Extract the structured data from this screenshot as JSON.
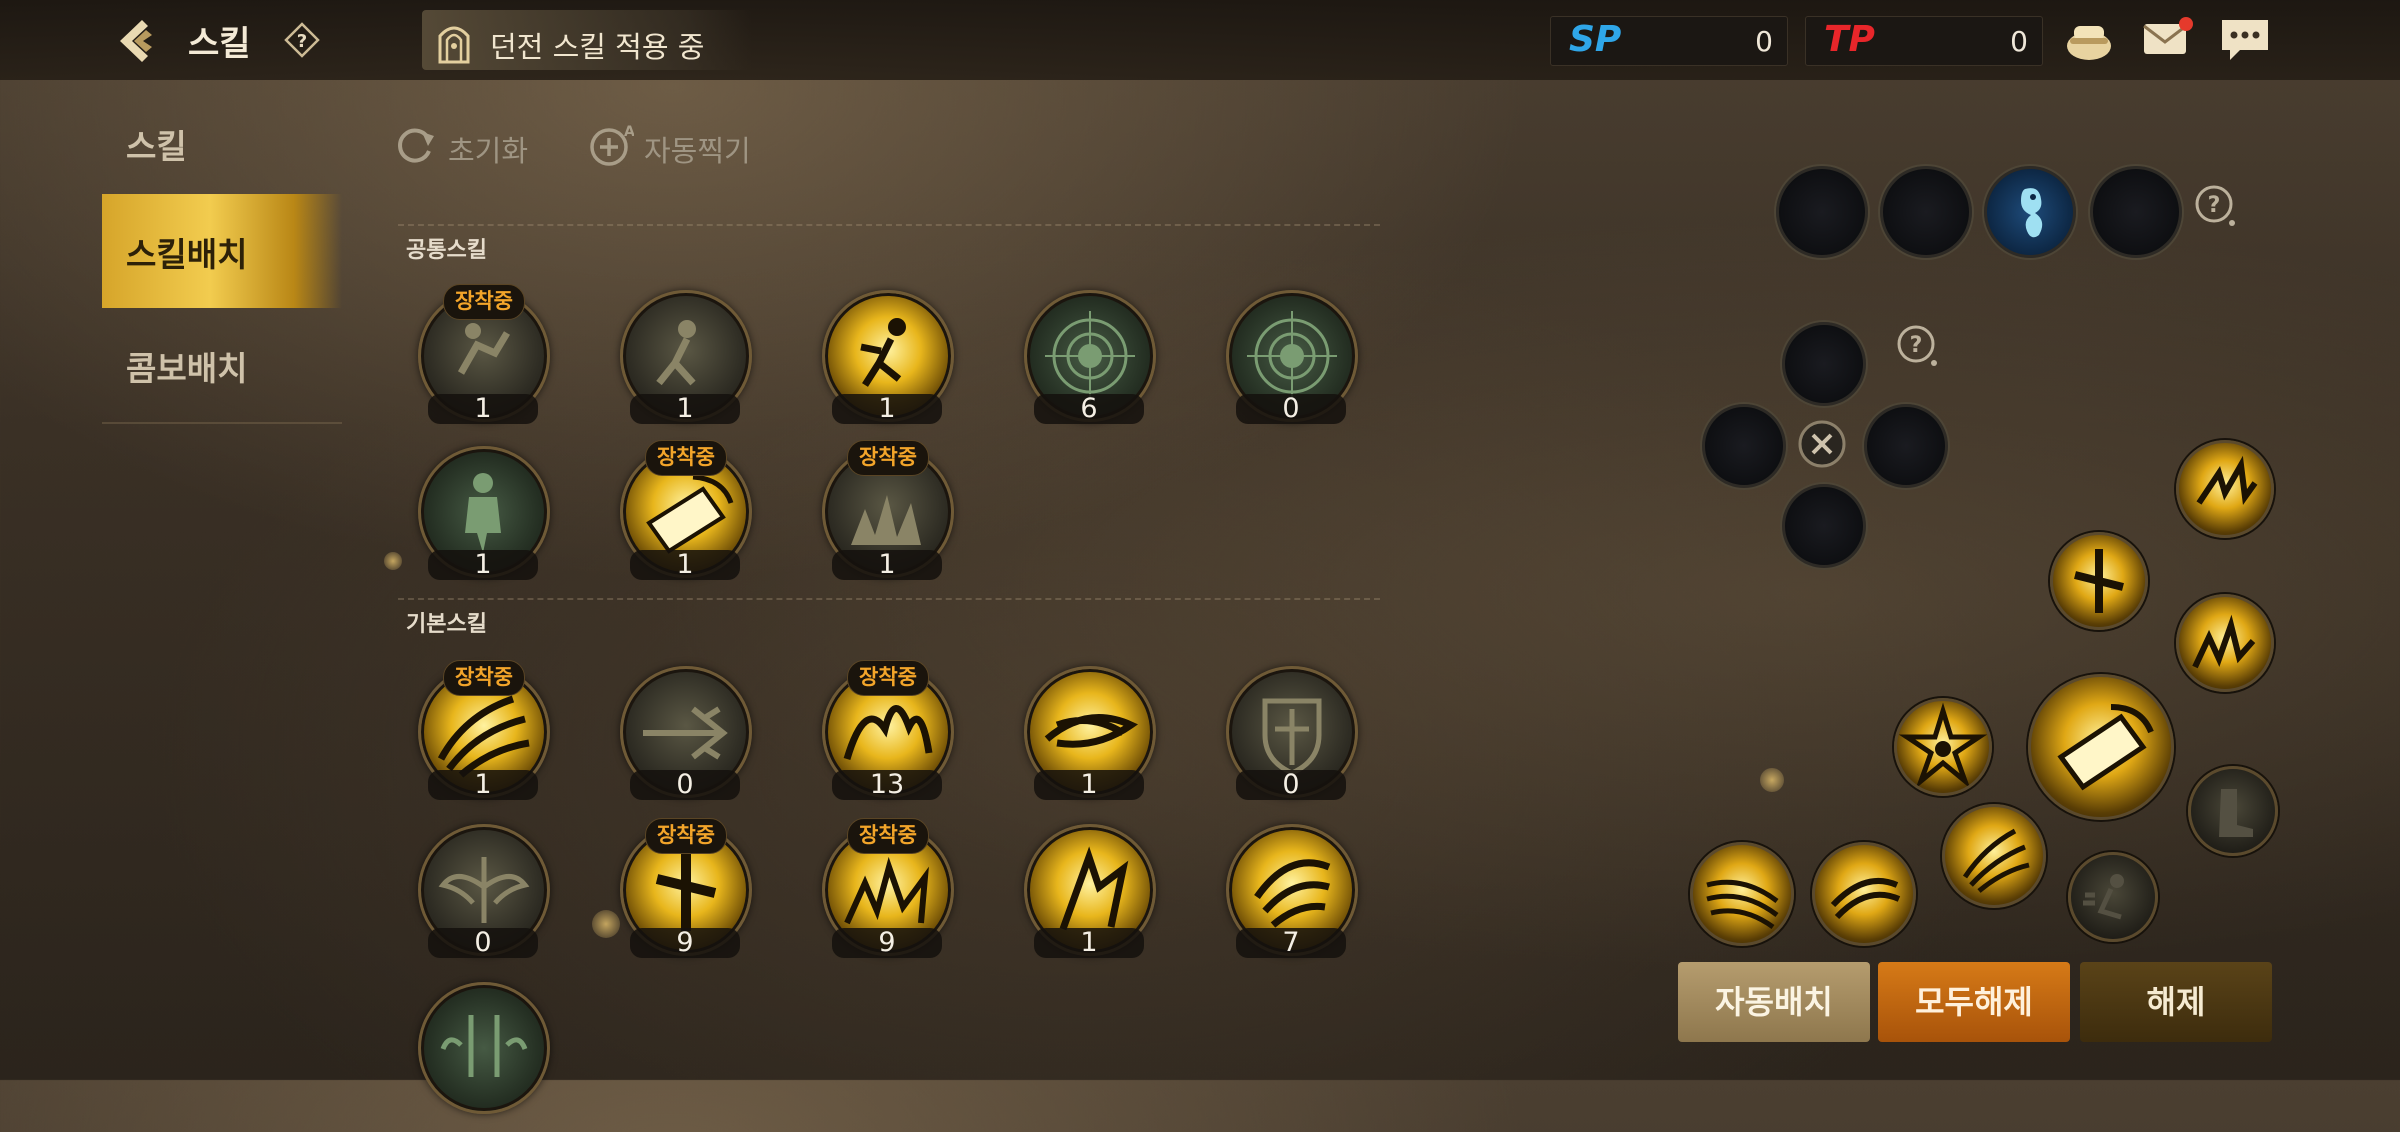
{
  "header": {
    "title": "스킬",
    "dungeon_status": "던전 스킬 적용 중",
    "sp": {
      "label": "SP",
      "value": "0",
      "color": "#2fa6e8"
    },
    "tp": {
      "label": "TP",
      "value": "0",
      "color": "#e8262a"
    }
  },
  "nav": {
    "items": [
      {
        "label": "스킬",
        "active": false
      },
      {
        "label": "스킬배치",
        "active": true
      },
      {
        "label": "콤보배치",
        "active": false
      }
    ]
  },
  "toolbar": {
    "reset_label": "초기화",
    "auto_pick_label": "자동찍기"
  },
  "common_skills": {
    "label": "공통스킬",
    "skills": [
      {
        "count": "1",
        "equipped": true
      },
      {
        "count": "1",
        "equipped": false
      },
      {
        "count": "1",
        "equipped": false
      },
      {
        "count": "6",
        "equipped": false
      },
      {
        "count": "0",
        "equipped": false
      },
      {
        "count": "1",
        "equipped": false
      },
      {
        "count": "1",
        "equipped": true
      },
      {
        "count": "1",
        "equipped": true
      }
    ]
  },
  "basic_skills": {
    "label": "기본스킬",
    "skills": [
      {
        "count": "1",
        "equipped": true
      },
      {
        "count": "0",
        "equipped": false
      },
      {
        "count": "13",
        "equipped": true
      },
      {
        "count": "1",
        "equipped": false
      },
      {
        "count": "0",
        "equipped": false
      },
      {
        "count": "0",
        "equipped": false
      },
      {
        "count": "9",
        "equipped": true
      },
      {
        "count": "9",
        "equipped": true
      },
      {
        "count": "1",
        "equipped": false
      },
      {
        "count": "7",
        "equipped": false
      },
      {
        "count": "",
        "equipped": false
      }
    ]
  },
  "equipped_badge": "장착중",
  "buttons": {
    "auto_place": "자동배치",
    "clear_all": "모두해제",
    "clear": "해제"
  }
}
